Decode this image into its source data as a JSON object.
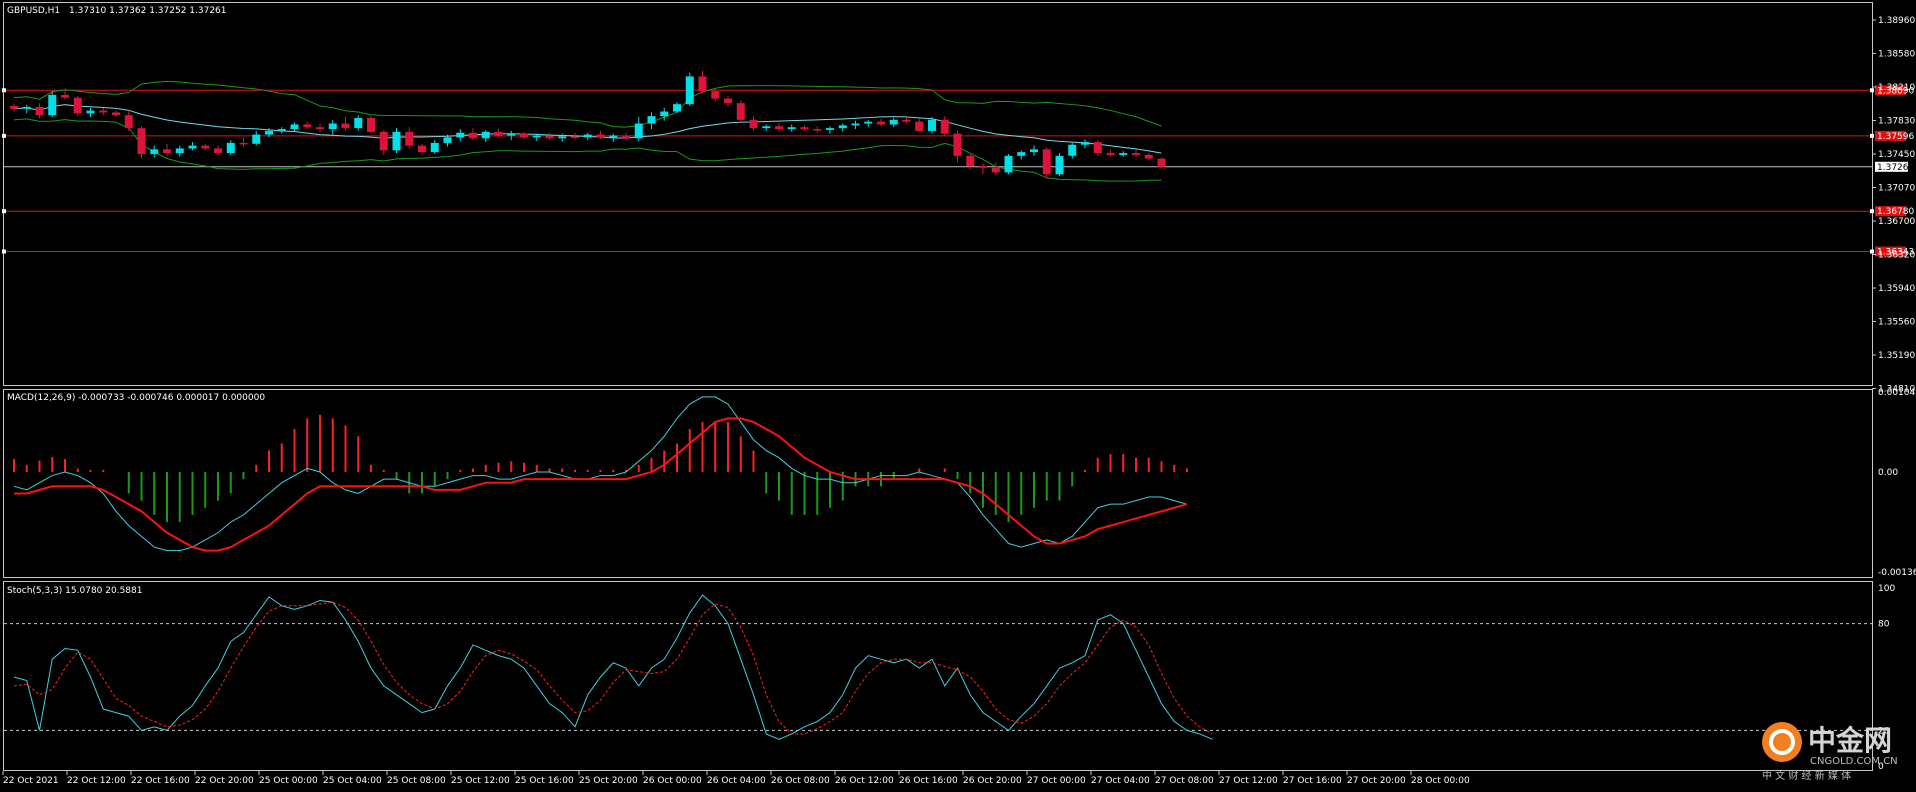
{
  "window": {
    "symbol_title": "GBPUSD,H1",
    "ohlc": "1.37310 1.37362 1.37252 1.37261"
  },
  "colors": {
    "background": "#000000",
    "frame": "#c8c8c8",
    "bull_candle": "#00e0e8",
    "bear_candle": "#dc143c",
    "bollinger": "#1a9a1a",
    "bollinger_mid": "#78d8e8",
    "level_line": "#e01010",
    "price_line": "#c0c0c0",
    "macd_pos": "#ff2020",
    "macd_neg": "#1a9a1a",
    "macd_main": "#40d0e0",
    "macd_signal": "#ff1010",
    "stoch_main": "#40d0e0",
    "stoch_signal": "#ff2020"
  },
  "price_axis": {
    "labels": [
      "1.38960",
      "1.38580",
      "1.38210",
      "1.37830",
      "1.37450",
      "1.37070",
      "1.36700",
      "1.36320",
      "1.35940",
      "1.35560",
      "1.35190",
      "1.34810"
    ],
    "current_price": "1.37261",
    "level_tags": [
      "1.38090",
      "1.37596",
      "1.36780",
      "1.36343"
    ]
  },
  "time_axis": {
    "labels": [
      "22 Oct 2021",
      "22 Oct 12:00",
      "22 Oct 16:00",
      "22 Oct 20:00",
      "25 Oct 00:00",
      "25 Oct 04:00",
      "25 Oct 08:00",
      "25 Oct 12:00",
      "25 Oct 16:00",
      "25 Oct 20:00",
      "26 Oct 00:00",
      "26 Oct 04:00",
      "26 Oct 08:00",
      "26 Oct 12:00",
      "26 Oct 16:00",
      "26 Oct 20:00",
      "27 Oct 00:00",
      "27 Oct 04:00",
      "27 Oct 08:00",
      "27 Oct 12:00",
      "27 Oct 16:00",
      "27 Oct 20:00",
      "28 Oct 00:00"
    ]
  },
  "macd": {
    "title": "MACD(12,26,9) -0.000733 -0.000746 0.000017 0.000000",
    "axis_labels": [
      "0.001049",
      "0.00",
      "-0.001364"
    ]
  },
  "stoch": {
    "title": "Stoch(5,3,3) 15.0780 20.5881",
    "axis_labels": [
      "100",
      "80",
      "20",
      "0"
    ]
  },
  "logo": {
    "cn_text": "中金网",
    "en_text": "CNGOLD.COM.CN",
    "sub_text": "中 文 财 经 新 媒 体"
  },
  "chart_data": {
    "type": "candlestick",
    "symbol": "GBPUSD",
    "timeframe": "H1",
    "y_range": [
      1.3481,
      1.3896
    ],
    "levels": [
      1.3809,
      1.37596,
      1.3678,
      1.36343
    ],
    "current": 1.37261,
    "candles": [
      [
        1.3792,
        1.3795,
        1.3786,
        1.3789
      ],
      [
        1.3789,
        1.3793,
        1.3784,
        1.3791
      ],
      [
        1.3791,
        1.3795,
        1.3779,
        1.3782
      ],
      [
        1.3782,
        1.3808,
        1.378,
        1.3804
      ],
      [
        1.3804,
        1.3811,
        1.3799,
        1.3801
      ],
      [
        1.3801,
        1.3803,
        1.3781,
        1.3784
      ],
      [
        1.3784,
        1.379,
        1.378,
        1.3787
      ],
      [
        1.3787,
        1.379,
        1.3782,
        1.3785
      ],
      [
        1.3785,
        1.3787,
        1.378,
        1.3782
      ],
      [
        1.3782,
        1.3787,
        1.3765,
        1.3768
      ],
      [
        1.3768,
        1.377,
        1.3735,
        1.374
      ],
      [
        1.374,
        1.3749,
        1.3736,
        1.3745
      ],
      [
        1.3745,
        1.3751,
        1.3738,
        1.3741
      ],
      [
        1.3741,
        1.3749,
        1.3737,
        1.3746
      ],
      [
        1.3746,
        1.3753,
        1.3744,
        1.3749
      ],
      [
        1.3749,
        1.3751,
        1.3744,
        1.3746
      ],
      [
        1.3746,
        1.3749,
        1.3739,
        1.3741
      ],
      [
        1.3741,
        1.3755,
        1.3739,
        1.3752
      ],
      [
        1.3752,
        1.3758,
        1.3748,
        1.3751
      ],
      [
        1.3751,
        1.3765,
        1.3749,
        1.3761
      ],
      [
        1.3761,
        1.3768,
        1.3758,
        1.3765
      ],
      [
        1.3765,
        1.3769,
        1.3762,
        1.3767
      ],
      [
        1.3767,
        1.3774,
        1.3764,
        1.3772
      ],
      [
        1.3772,
        1.3775,
        1.3767,
        1.3769
      ],
      [
        1.3769,
        1.3772,
        1.3764,
        1.3767
      ],
      [
        1.3767,
        1.3777,
        1.3761,
        1.3773
      ],
      [
        1.3773,
        1.378,
        1.3766,
        1.3768
      ],
      [
        1.3768,
        1.3782,
        1.3765,
        1.3779
      ],
      [
        1.3779,
        1.3781,
        1.3762,
        1.3764
      ],
      [
        1.3764,
        1.3766,
        1.3739,
        1.3744
      ],
      [
        1.3744,
        1.3768,
        1.3741,
        1.3764
      ],
      [
        1.3764,
        1.3769,
        1.3746,
        1.3749
      ],
      [
        1.3749,
        1.3751,
        1.3739,
        1.3742
      ],
      [
        1.3742,
        1.3755,
        1.374,
        1.3752
      ],
      [
        1.3752,
        1.3761,
        1.3748,
        1.3758
      ],
      [
        1.3758,
        1.3767,
        1.3754,
        1.3763
      ],
      [
        1.3763,
        1.3768,
        1.3755,
        1.3757
      ],
      [
        1.3757,
        1.3766,
        1.3753,
        1.3764
      ],
      [
        1.3764,
        1.3767,
        1.3758,
        1.376
      ],
      [
        1.376,
        1.3765,
        1.3755,
        1.3762
      ],
      [
        1.3762,
        1.3764,
        1.3756,
        1.3758
      ],
      [
        1.3758,
        1.3762,
        1.3754,
        1.376
      ],
      [
        1.376,
        1.3763,
        1.3755,
        1.3757
      ],
      [
        1.3757,
        1.3762,
        1.3753,
        1.3759
      ],
      [
        1.3759,
        1.3763,
        1.3756,
        1.3758
      ],
      [
        1.3758,
        1.3763,
        1.3755,
        1.3761
      ],
      [
        1.3761,
        1.3765,
        1.3756,
        1.3758
      ],
      [
        1.3758,
        1.3762,
        1.3753,
        1.376
      ],
      [
        1.376,
        1.3763,
        1.3755,
        1.3757
      ],
      [
        1.3757,
        1.378,
        1.3754,
        1.3773
      ],
      [
        1.3773,
        1.3785,
        1.3767,
        1.3781
      ],
      [
        1.3781,
        1.379,
        1.3776,
        1.3786
      ],
      [
        1.3786,
        1.3796,
        1.3784,
        1.3794
      ],
      [
        1.3794,
        1.3828,
        1.3792,
        1.3824
      ],
      [
        1.3824,
        1.383,
        1.3805,
        1.3808
      ],
      [
        1.3808,
        1.3811,
        1.3797,
        1.38
      ],
      [
        1.38,
        1.3803,
        1.3791,
        1.3795
      ],
      [
        1.3795,
        1.3798,
        1.3774,
        1.3777
      ],
      [
        1.3777,
        1.3781,
        1.3765,
        1.3768
      ],
      [
        1.3768,
        1.3772,
        1.3765,
        1.377
      ],
      [
        1.377,
        1.3773,
        1.3764,
        1.3767
      ],
      [
        1.3767,
        1.3772,
        1.3764,
        1.3769
      ],
      [
        1.3769,
        1.3771,
        1.3765,
        1.3767
      ],
      [
        1.3767,
        1.377,
        1.3763,
        1.3766
      ],
      [
        1.3766,
        1.377,
        1.3762,
        1.3768
      ],
      [
        1.3768,
        1.3773,
        1.3764,
        1.3771
      ],
      [
        1.3771,
        1.3776,
        1.3767,
        1.3773
      ],
      [
        1.3773,
        1.3777,
        1.3769,
        1.3775
      ],
      [
        1.3775,
        1.3778,
        1.377,
        1.3772
      ],
      [
        1.3772,
        1.3779,
        1.3769,
        1.3777
      ],
      [
        1.3777,
        1.378,
        1.3773,
        1.3775
      ],
      [
        1.3775,
        1.3779,
        1.377,
        1.3765
      ],
      [
        1.3765,
        1.378,
        1.3762,
        1.3777
      ],
      [
        1.3777,
        1.3781,
        1.3759,
        1.3762
      ],
      [
        1.3762,
        1.3765,
        1.3731,
        1.3738
      ],
      [
        1.3738,
        1.3741,
        1.3723,
        1.3727
      ],
      [
        1.3727,
        1.373,
        1.3718,
        1.3725
      ],
      [
        1.3725,
        1.3731,
        1.3717,
        1.372
      ],
      [
        1.372,
        1.374,
        1.3718,
        1.3738
      ],
      [
        1.3738,
        1.3744,
        1.3734,
        1.3742
      ],
      [
        1.3742,
        1.3749,
        1.3738,
        1.3745
      ],
      [
        1.3745,
        1.3747,
        1.3714,
        1.3718
      ],
      [
        1.3718,
        1.3741,
        1.3716,
        1.3738
      ],
      [
        1.3738,
        1.3752,
        1.3735,
        1.375
      ],
      [
        1.375,
        1.3756,
        1.3746,
        1.3753
      ],
      [
        1.3753,
        1.3755,
        1.3738,
        1.3741
      ],
      [
        1.3741,
        1.3744,
        1.3737,
        1.3739
      ],
      [
        1.3739,
        1.3743,
        1.3737,
        1.3741
      ],
      [
        1.3741,
        1.3745,
        1.3737,
        1.3739
      ],
      [
        1.3739,
        1.3741,
        1.3733,
        1.3735
      ],
      [
        1.3735,
        1.3736,
        1.3725,
        1.3726
      ]
    ],
    "macd_hist": [
      0.00018,
      0.0001,
      0.00016,
      0.00021,
      0.00018,
      5e-05,
      3e-05,
      3e-05,
      0.0,
      -0.0003,
      -0.0004,
      -0.0006,
      -0.0007,
      -0.0007,
      -0.0006,
      -0.0005,
      -0.0004,
      -0.0003,
      -0.0001,
      0.0001,
      0.0003,
      0.0004,
      0.0006,
      0.00075,
      0.0008,
      0.00075,
      0.00065,
      0.0005,
      0.0001,
      3e-05,
      -0.0001,
      -0.0003,
      -0.0003,
      -0.0002,
      -0.0001,
      3e-05,
      5e-05,
      0.0001,
      0.00013,
      0.00015,
      0.00013,
      0.0001,
      5e-05,
      5e-05,
      3e-05,
      3e-05,
      3e-05,
      3e-05,
      3e-05,
      0.0001,
      0.0002,
      0.0003,
      0.0004,
      0.0006,
      0.0007,
      0.0007,
      0.0007,
      0.0005,
      0.0003,
      -0.0003,
      -0.0004,
      -0.0006,
      -0.0006,
      -0.0006,
      -0.0005,
      -0.0004,
      -0.0002,
      -0.0002,
      -0.0002,
      -0.0001,
      0.0,
      5e-05,
      0.0,
      5e-05,
      -0.0001,
      -0.0003,
      -0.0005,
      -0.0006,
      -0.0007,
      -0.0006,
      -0.0005,
      -0.0004,
      -0.0004,
      -0.0002,
      3e-05,
      0.0002,
      0.00025,
      0.00025,
      0.0002,
      0.0002,
      0.00015,
      0.0001,
      5e-05
    ],
    "stoch_k": [
      50,
      48,
      20,
      60,
      66,
      65,
      50,
      32,
      30,
      28,
      20,
      22,
      20,
      28,
      34,
      45,
      55,
      70,
      75,
      85,
      95,
      90,
      88,
      90,
      93,
      92,
      82,
      70,
      55,
      45,
      40,
      35,
      30,
      32,
      45,
      55,
      68,
      65,
      62,
      60,
      55,
      45,
      35,
      30,
      22,
      40,
      50,
      58,
      55,
      45,
      55,
      60,
      72,
      86,
      96,
      90,
      80,
      60,
      40,
      18,
      15,
      18,
      22,
      25,
      30,
      40,
      55,
      62,
      60,
      58,
      60,
      55,
      60,
      45,
      55,
      40,
      30,
      25,
      20,
      28,
      35,
      45,
      55,
      58,
      62,
      82,
      85,
      80,
      65,
      50,
      35,
      25,
      20,
      18,
      15
    ],
    "stoch_d": [
      45,
      46,
      40,
      43,
      55,
      64,
      60,
      49,
      38,
      34,
      28,
      25,
      22,
      23,
      26,
      32,
      42,
      55,
      67,
      78,
      87,
      90,
      90,
      90,
      91,
      92,
      89,
      82,
      70,
      57,
      47,
      40,
      35,
      32,
      35,
      42,
      53,
      62,
      65,
      63,
      59,
      54,
      45,
      37,
      30,
      31,
      37,
      47,
      54,
      53,
      52,
      53,
      60,
      72,
      85,
      91,
      89,
      78,
      62,
      40,
      25,
      18,
      18,
      21,
      25,
      30,
      42,
      52,
      58,
      60,
      60,
      58,
      58,
      56,
      54,
      50,
      42,
      32,
      26,
      24,
      28,
      35,
      45,
      52,
      58,
      68,
      78,
      82,
      78,
      68,
      52,
      38,
      28,
      22,
      18
    ],
    "macd_main": [
      -0.0002,
      -0.00025,
      -0.00015,
      -5e-05,
      0.0,
      -5e-05,
      -0.00015,
      -0.0003,
      -0.00055,
      -0.00075,
      -0.0009,
      -0.00105,
      -0.0011,
      -0.0011,
      -0.00105,
      -0.00095,
      -0.00085,
      -0.0007,
      -0.0006,
      -0.00045,
      -0.0003,
      -0.00015,
      -5e-05,
      5e-05,
      0.0,
      -0.00015,
      -0.00025,
      -0.0003,
      -0.0002,
      -0.0001,
      -0.0001,
      -0.00015,
      -0.0002,
      -0.0002,
      -0.00015,
      -0.0001,
      -5e-05,
      -5e-05,
      -0.0001,
      -0.0001,
      -5e-05,
      0.0,
      0.0,
      -5e-05,
      -0.0001,
      -0.0001,
      -5e-05,
      -5e-05,
      0.0,
      0.00015,
      0.0003,
      0.0005,
      0.00075,
      0.00095,
      0.00105,
      0.00105,
      0.00095,
      0.0007,
      0.00045,
      0.0003,
      0.0002,
      5e-05,
      -5e-05,
      -0.0001,
      -0.0001,
      -0.00015,
      -0.00015,
      -0.0001,
      -5e-05,
      -5e-05,
      -5e-05,
      0.0,
      -5e-05,
      -0.0001,
      -0.00015,
      -0.00035,
      -0.0006,
      -0.0008,
      -0.001,
      -0.00105,
      -0.001,
      -0.00095,
      -0.001,
      -0.0009,
      -0.0007,
      -0.0005,
      -0.00045,
      -0.00045,
      -0.0004,
      -0.00035,
      -0.00035,
      -0.0004,
      -0.00045
    ],
    "macd_signal": [
      -0.0003,
      -0.0003,
      -0.00025,
      -0.0002,
      -0.0002,
      -0.0002,
      -0.0002,
      -0.00025,
      -0.00035,
      -0.00045,
      -0.00055,
      -0.0007,
      -0.00085,
      -0.00095,
      -0.00105,
      -0.0011,
      -0.0011,
      -0.00105,
      -0.00095,
      -0.00085,
      -0.00075,
      -0.0006,
      -0.00045,
      -0.0003,
      -0.0002,
      -0.0002,
      -0.0002,
      -0.0002,
      -0.0002,
      -0.0002,
      -0.0002,
      -0.0002,
      -0.0002,
      -0.00025,
      -0.00025,
      -0.00025,
      -0.0002,
      -0.00015,
      -0.00015,
      -0.00015,
      -0.0001,
      -0.0001,
      -0.0001,
      -0.0001,
      -0.0001,
      -0.0001,
      -0.0001,
      -0.0001,
      -0.0001,
      -5e-05,
      0.0,
      0.0001,
      0.00025,
      0.0004,
      0.00055,
      0.0007,
      0.00075,
      0.00075,
      0.0007,
      0.0006,
      0.0005,
      0.00035,
      0.0002,
      0.0001,
      0.0,
      -5e-05,
      -0.0001,
      -0.0001,
      -0.0001,
      -0.0001,
      -0.0001,
      -0.0001,
      -0.0001,
      -0.0001,
      -0.00015,
      -0.0002,
      -0.0003,
      -0.00045,
      -0.0006,
      -0.00075,
      -0.0009,
      -0.001,
      -0.001,
      -0.00095,
      -0.0009,
      -0.0008,
      -0.00075,
      -0.0007,
      -0.00065,
      -0.0006,
      -0.00055,
      -0.0005,
      -0.00045
    ]
  }
}
